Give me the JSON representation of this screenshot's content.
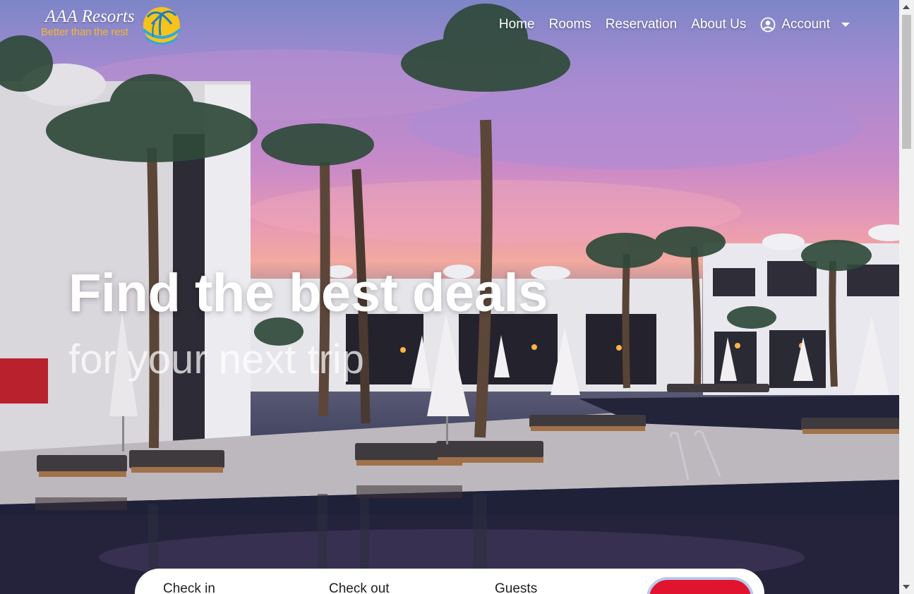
{
  "brand": {
    "name": "AAA Resorts",
    "tagline": "Better than the rest",
    "logo_icon": "palm-sun-icon"
  },
  "nav": {
    "items": [
      {
        "label": "Home"
      },
      {
        "label": "Rooms"
      },
      {
        "label": "Reservation"
      },
      {
        "label": "About Us"
      }
    ],
    "account": {
      "label": "Account",
      "icon": "user-circle-icon"
    }
  },
  "hero": {
    "headline": "Find the best deals",
    "subheadline": "for your next trip"
  },
  "booking": {
    "check_in_label": "Check in",
    "check_out_label": "Check out",
    "guests_label": "Guests"
  },
  "colors": {
    "tagline": "#f5b52e",
    "search_button": "#e0142e",
    "nav_text": "#ffffff"
  }
}
